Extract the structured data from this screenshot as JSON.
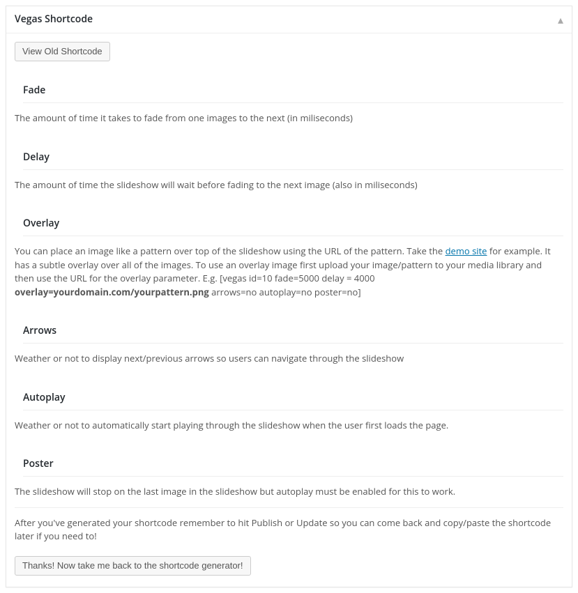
{
  "panel": {
    "title": "Vegas Shortcode"
  },
  "buttons": {
    "view_old": "View Old Shortcode",
    "back_to_generator": "Thanks! Now take me back to the shortcode generator!"
  },
  "sections": {
    "fade": {
      "heading": "Fade",
      "desc": "The amount of time it takes to fade from one images to the next (in miliseconds)"
    },
    "delay": {
      "heading": "Delay",
      "desc": "The amount of time the slideshow will wait before fading to the next image (also in miliseconds)"
    },
    "overlay": {
      "heading": "Overlay",
      "desc_before_link": "You can place an image like a pattern over top of the slideshow using the URL of the pattern. Take the ",
      "link_text": "demo site",
      "desc_after_link": " for example. It has a subtle overlay over all of the images. To use an overlay image first upload your image/pattern to your media library and then use the URL for the overlay parameter. E.g. [vegas id=10 fade=5000 delay = 4000 ",
      "desc_bold": "overlay=yourdomain.com/yourpattern.png",
      "desc_after_bold": " arrows=no autoplay=no poster=no]"
    },
    "arrows": {
      "heading": "Arrows",
      "desc": "Weather or not to display next/previous arrows so users can navigate through the slideshow"
    },
    "autoplay": {
      "heading": "Autoplay",
      "desc": "Weather or not to automatically start playing through the slideshow when the user first loads the page."
    },
    "poster": {
      "heading": "Poster",
      "desc": "The slideshow will stop on the last image in the slideshow but autoplay must be enabled for this to work."
    }
  },
  "note": "After you've generated your shortcode remember to hit Publish or Update so you can come back and copy/paste the shortcode later if you need to!"
}
